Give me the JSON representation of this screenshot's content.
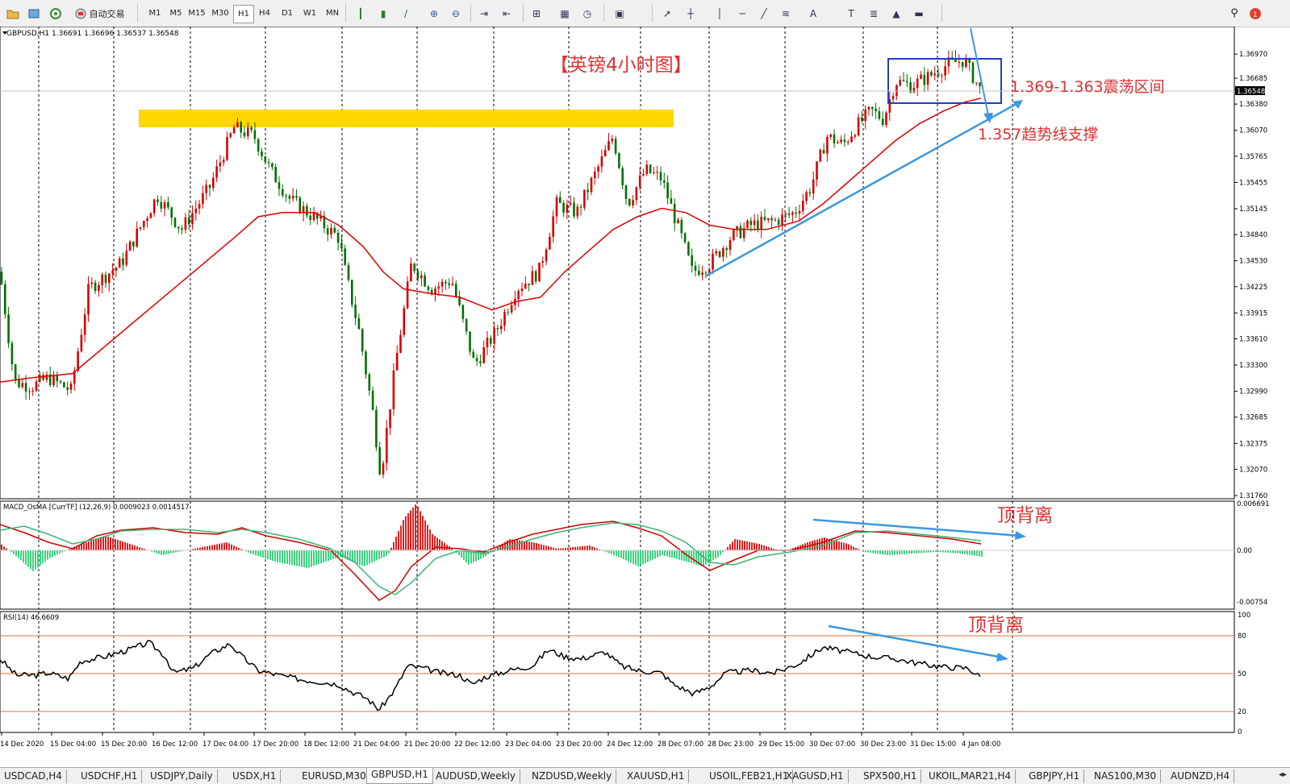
{
  "toolbar": {
    "auto_trading_label": "自动交易",
    "timeframes": [
      "M1",
      "M5",
      "M15",
      "M30",
      "H1",
      "H4",
      "D1",
      "W1",
      "MN"
    ],
    "active_timeframe": "H1",
    "icons": [
      "folder-icon",
      "profile-icon",
      "signal-icon",
      "auto-trading-icon",
      "bar-chart-icon",
      "candle-chart-icon",
      "line-chart-icon",
      "zoom-in-icon",
      "zoom-out-icon",
      "autoscroll-icon",
      "chart-shift-icon",
      "indicators-icon",
      "templates-icon",
      "periods-icon",
      "crosshair-cursor-icon",
      "cursor-icon",
      "crosshair-icon",
      "vertical-line-icon",
      "horizontal-line-icon",
      "trendline-icon",
      "fibonacci-icon",
      "text-icon",
      "text-label-icon",
      "fibo-channel-icon",
      "arrow-icon",
      "rectangle-icon",
      "search-icon",
      "notification-icon"
    ]
  },
  "chart": {
    "symbol_info": "GBPUSD,H1  1.36691 1.36696 1.36537 1.36548",
    "title_annotation": "【英镑4小时图】",
    "range_annotation": "1.369-1.363震荡区间",
    "support_annotation": "1.357趋势线支撑",
    "current_price": "1.36548",
    "price_ticks": [
      "1.36970",
      "1.36685",
      "1.36380",
      "1.36070",
      "1.35765",
      "1.35455",
      "1.35145",
      "1.34840",
      "1.34530",
      "1.34225",
      "1.33915",
      "1.33610",
      "1.33300",
      "1.32990",
      "1.32685",
      "1.32375",
      "1.32070",
      "1.31760"
    ],
    "time_labels": [
      "14 Dec 2020",
      "15 Dec 04:00",
      "15 Dec 20:00",
      "16 Dec 12:00",
      "17 Dec 04:00",
      "17 Dec 20:00",
      "18 Dec 12:00",
      "21 Dec 04:00",
      "21 Dec 20:00",
      "22 Dec 12:00",
      "23 Dec 04:00",
      "23 Dec 20:00",
      "24 Dec 12:00",
      "28 Dec 07:00",
      "28 Dec 23:00",
      "29 Dec 15:00",
      "30 Dec 07:00",
      "30 Dec 23:00",
      "31 Dec 15:00",
      "4 Jan 08:00"
    ],
    "colors": {
      "bull": "#d40000",
      "bear": "#007000",
      "ma": "#e00000",
      "resistance_band": "#ffd700",
      "trendline": "#3a97e0",
      "box": "#1f3fbf",
      "annotation": "#e03030"
    }
  },
  "macd": {
    "label": "MACD_OsMA [CurrTF] (12,26,9) 0.0009023 0.0014517",
    "annotation": "顶背离",
    "ticks": [
      "0.006691",
      "0.00",
      "-0.00754"
    ]
  },
  "rsi": {
    "label": "RSI(14) 46.6609",
    "annotation": "顶背离",
    "ticks": [
      "100",
      "80",
      "50",
      "20",
      "0"
    ]
  },
  "tabs": [
    "USDCAD,H4",
    "USDCHF,H1",
    "USDJPY,Daily",
    "USDX,H1",
    "EURUSD,M30",
    "GBPUSD,H1",
    "AUDUSD,Weekly",
    "NZDUSD,Weekly",
    "XAUUSD,H1",
    "USOIL,FEB21,H1",
    "XAGUSD,H1",
    "SPX500,H1",
    "UKOIL,MAR21,H4",
    "GBPJPY,H1",
    "NAS100,M30",
    "AUDNZD,H4"
  ],
  "active_tab": "GBPUSD,H1",
  "chart_data": {
    "type": "candlestick",
    "symbol": "GBPUSD",
    "timeframe": "H1",
    "ylim": [
      1.3176,
      1.3699
    ],
    "last": {
      "open": 1.36691,
      "high": 1.36696,
      "low": 1.36537,
      "close": 1.36548
    },
    "resistance_zone": [
      1.361,
      1.363
    ],
    "range_zone": [
      1.363,
      1.369
    ],
    "trendline_support": 1.357,
    "approx_path": [
      {
        "x": "14 Dec 2020",
        "close": 1.344
      },
      {
        "x": "14 Dec",
        "close": 1.331
      },
      {
        "x": "15 Dec 04:00",
        "close": 1.3305
      },
      {
        "x": "15 Dec 20:00",
        "close": 1.344
      },
      {
        "x": "16 Dec 12:00",
        "close": 1.353
      },
      {
        "x": "17 Dec 04:00",
        "close": 1.3615
      },
      {
        "x": "17 Dec 20:00",
        "close": 1.356
      },
      {
        "x": "18 Dec 12:00",
        "close": 1.3495
      },
      {
        "x": "21 Dec 04:00",
        "close": 1.338
      },
      {
        "x": "21 Dec",
        "close": 1.3195
      },
      {
        "x": "21 Dec 20:00",
        "close": 1.345
      },
      {
        "x": "22 Dec 12:00",
        "close": 1.334
      },
      {
        "x": "23 Dec 04:00",
        "close": 1.342
      },
      {
        "x": "23 Dec 20:00",
        "close": 1.3545
      },
      {
        "x": "24 Dec 12:00",
        "close": 1.356
      },
      {
        "x": "28 Dec 07:00",
        "close": 1.344
      },
      {
        "x": "28 Dec 23:00",
        "close": 1.349
      },
      {
        "x": "29 Dec 15:00",
        "close": 1.353
      },
      {
        "x": "30 Dec 07:00",
        "close": 1.359
      },
      {
        "x": "30 Dec 23:00",
        "close": 1.3655
      },
      {
        "x": "31 Dec 15:00",
        "close": 1.367
      },
      {
        "x": "4 Jan 08:00",
        "close": 1.3655
      }
    ],
    "rsi_levels": [
      80,
      50,
      20
    ],
    "rsi_last": 46.6609,
    "macd_last": 0.0009023,
    "signal_last": 0.0014517
  }
}
